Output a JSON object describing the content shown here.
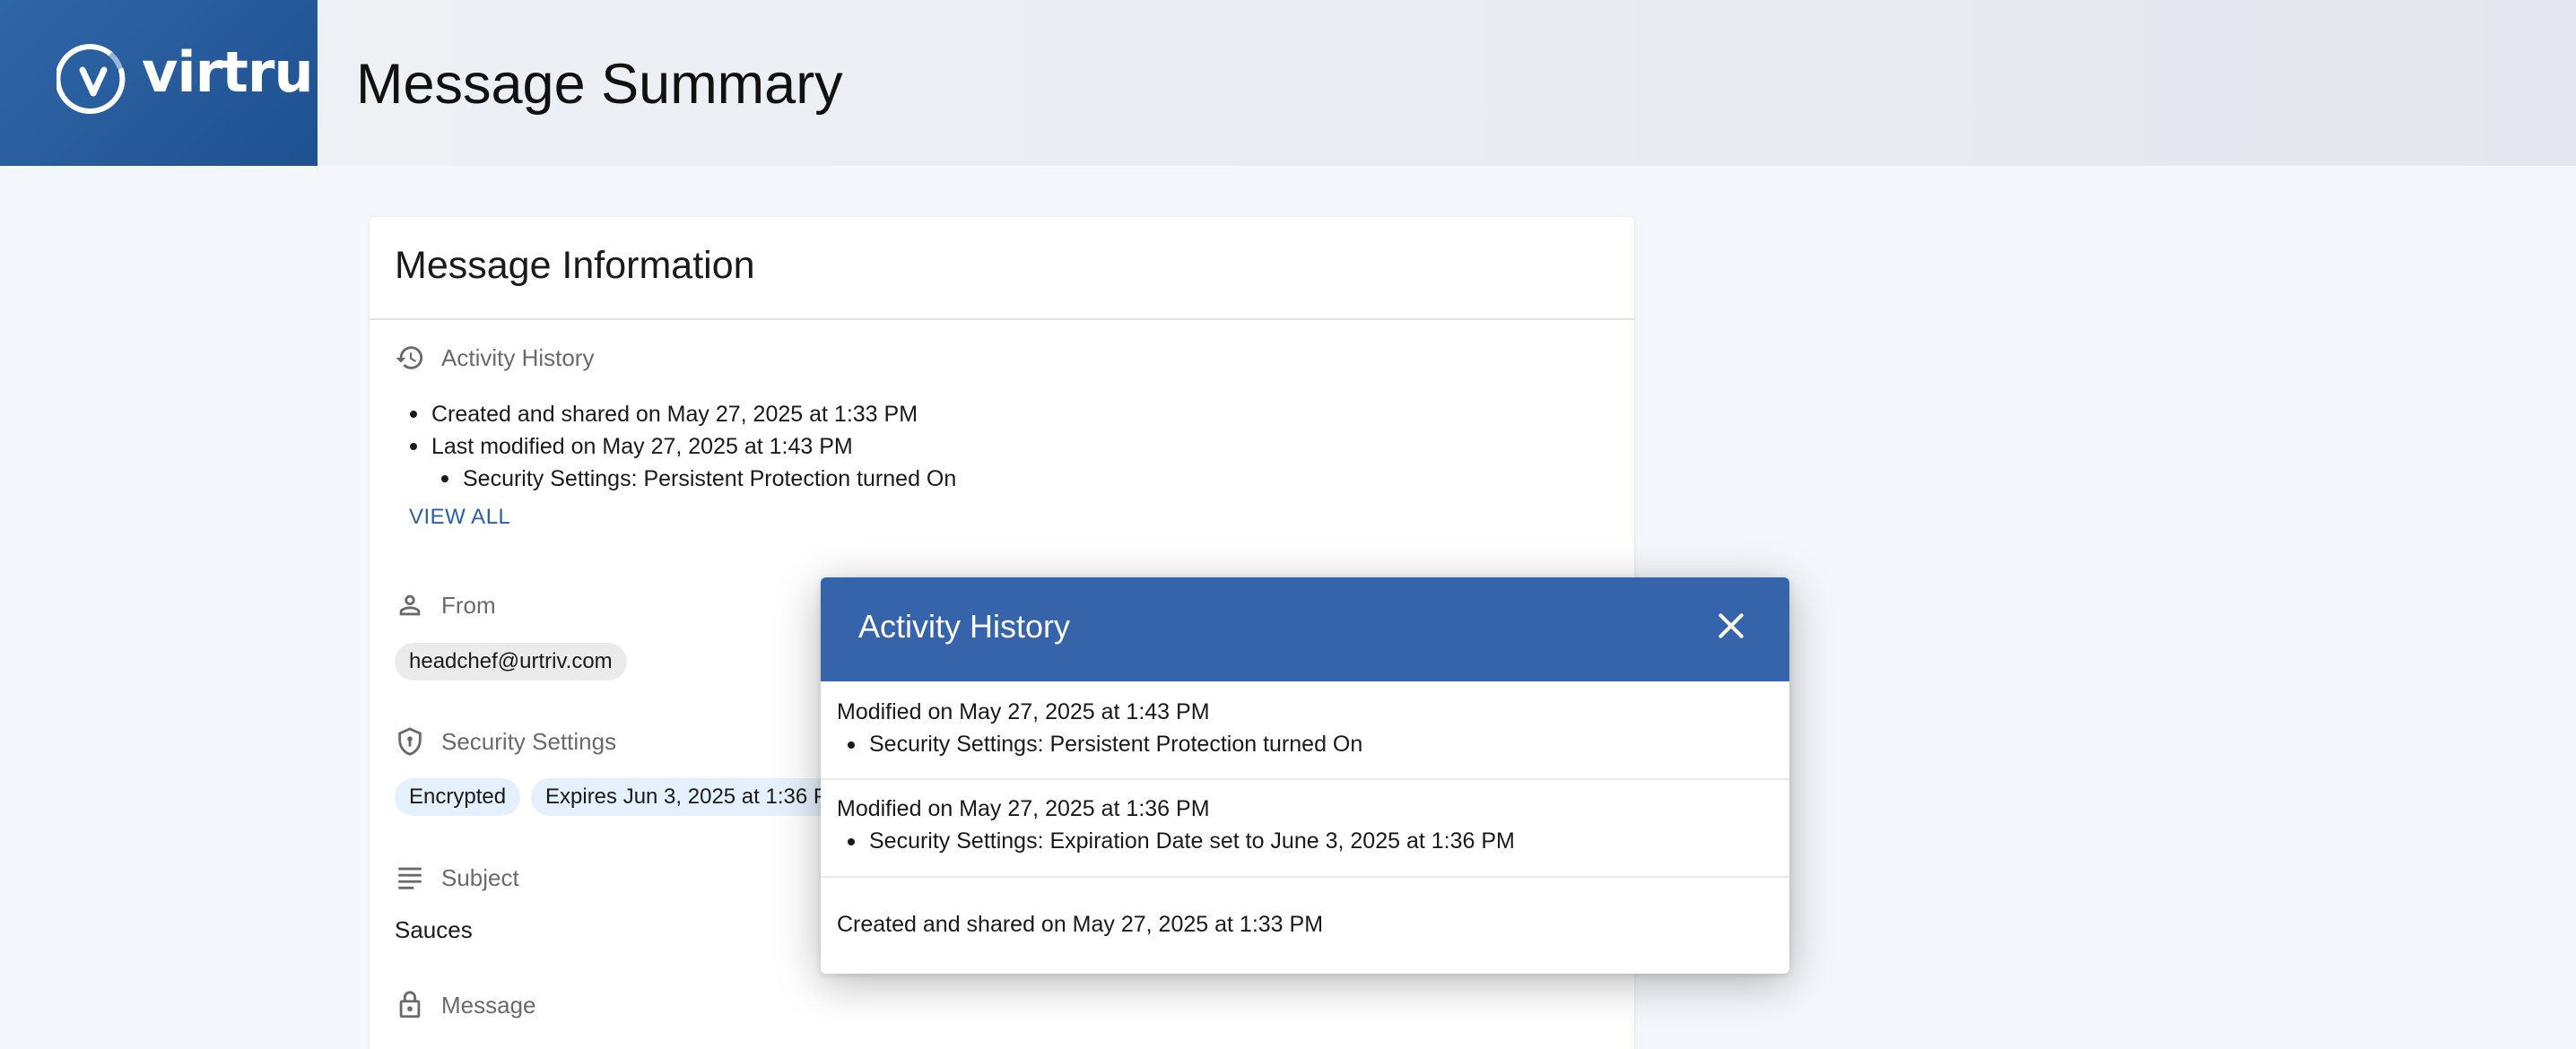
{
  "brand": {
    "name": "virtru",
    "primary_color": "#2f66a8",
    "modal_header_color": "#3564ab",
    "link_color": "#2d5fa8"
  },
  "header": {
    "title": "Message Summary"
  },
  "card": {
    "title": "Message Information",
    "activity": {
      "label": "Activity History",
      "icon": "history-icon",
      "items": [
        "Created and shared on May 27, 2025 at 1:33 PM",
        "Last modified on May 27, 2025 at 1:43 PM"
      ],
      "sub_items": [
        "Security Settings: Persistent Protection turned On"
      ],
      "view_all": "VIEW ALL"
    },
    "from": {
      "label": "From",
      "icon": "person-icon",
      "value": "headchef@urtriv.com"
    },
    "security": {
      "label": "Security Settings",
      "icon": "shield-icon",
      "chips": [
        "Encrypted",
        "Expires Jun 3, 2025 at 1:36 PM"
      ]
    },
    "subject": {
      "label": "Subject",
      "icon": "lines-icon",
      "value": "Sauces"
    },
    "message": {
      "label": "Message",
      "icon": "lock-icon"
    }
  },
  "modal": {
    "title": "Activity History",
    "close_icon": "close-icon",
    "entries": [
      {
        "title": "Modified on May 27, 2025 at 1:43 PM",
        "details": [
          "Security Settings: Persistent Protection turned On"
        ]
      },
      {
        "title": "Modified on May 27, 2025 at 1:36 PM",
        "details": [
          "Security Settings: Expiration Date set to June 3, 2025 at 1:36 PM"
        ]
      },
      {
        "title": "Created and shared on May 27, 2025 at 1:33 PM",
        "details": []
      }
    ]
  }
}
